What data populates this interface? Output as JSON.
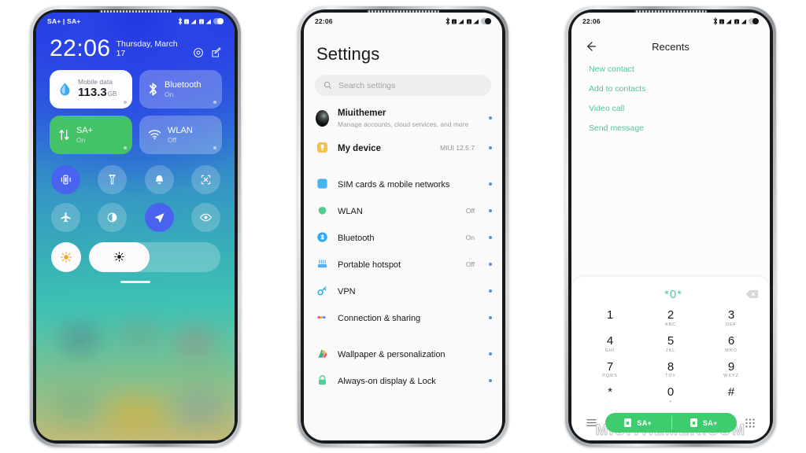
{
  "page": {
    "background": "#ffffff",
    "watermark": "MIUITHEMER.COM"
  },
  "control_center": {
    "status_bar": {
      "carrier": "SA+ | SA+",
      "icons": [
        "bluetooth-icon",
        "sim1-signal-icon",
        "sim2-signal-icon",
        "battery-icon"
      ]
    },
    "clock": {
      "time": "22:06",
      "date": "Thursday, March 17"
    },
    "header_icons": [
      "settings-gear-icon",
      "edit-icon"
    ],
    "big_tiles": [
      {
        "name": "mobile-data",
        "label": "Mobile data",
        "value": "113.3",
        "unit": "GB",
        "style": "white",
        "icon": "water-drop-icon"
      },
      {
        "name": "bluetooth",
        "label": "Bluetooth",
        "value": "On",
        "style": "blue",
        "icon": "bluetooth-icon"
      },
      {
        "name": "sa-plus",
        "label": "SA+",
        "value": "On",
        "style": "green",
        "icon": "data-transfer-icon"
      },
      {
        "name": "wlan",
        "label": "WLAN",
        "value": "Off",
        "style": "blue",
        "icon": "wifi-icon"
      }
    ],
    "toggles": [
      {
        "name": "vibrate",
        "icon": "vibrate-icon",
        "active": true
      },
      {
        "name": "flashlight",
        "icon": "flashlight-icon",
        "active": false
      },
      {
        "name": "silent",
        "icon": "bell-icon",
        "active": false
      },
      {
        "name": "screenshot",
        "icon": "screenshot-icon",
        "active": false
      },
      {
        "name": "airplane-mode",
        "icon": "airplane-icon",
        "active": false
      },
      {
        "name": "dark-mode",
        "icon": "contrast-icon",
        "active": false
      },
      {
        "name": "location",
        "icon": "location-arrow-icon",
        "active": true
      },
      {
        "name": "reading-mode",
        "icon": "eye-icon",
        "active": false
      }
    ],
    "brightness": {
      "auto_icon": "sun-auto-icon",
      "slider_icon": "brightness-icon",
      "level_percent": 46
    }
  },
  "settings": {
    "status_bar": {
      "time": "22:06",
      "icons": [
        "bluetooth-icon",
        "sim1-signal-icon",
        "sim2-signal-icon",
        "battery-icon"
      ]
    },
    "title": "Settings",
    "search_placeholder": "Search settings",
    "account": {
      "name": "Miuithemer",
      "subtitle": "Manage accounts, cloud services, and more",
      "icon": "avatar"
    },
    "items": [
      {
        "label": "My device",
        "value": "MIUI 12.5.7",
        "icon": "device-icon",
        "bold": true
      },
      {
        "label": "SIM cards & mobile networks",
        "value": "",
        "icon": "sim-card-icon",
        "group_start": true
      },
      {
        "label": "WLAN",
        "value": "Off",
        "icon": "wifi-icon"
      },
      {
        "label": "Bluetooth",
        "value": "On",
        "icon": "bluetooth-icon"
      },
      {
        "label": "Portable hotspot",
        "value": "Off",
        "icon": "hotspot-icon"
      },
      {
        "label": "VPN",
        "value": "",
        "icon": "vpn-key-icon"
      },
      {
        "label": "Connection & sharing",
        "value": "",
        "icon": "connection-sharing-icon"
      },
      {
        "label": "Wallpaper & personalization",
        "value": "",
        "icon": "wallpaper-icon",
        "group_start": true
      },
      {
        "label": "Always-on display & Lock",
        "value": "",
        "icon": "lock-screen-icon"
      }
    ]
  },
  "dialer": {
    "status_bar": {
      "time": "22:06",
      "icons": [
        "bluetooth-icon",
        "sim1-signal-icon",
        "sim2-signal-icon",
        "battery-icon"
      ]
    },
    "back_icon": "back-arrow-icon",
    "title": "Recents",
    "actions": [
      "New contact",
      "Add to contacts",
      "Video call",
      "Send message"
    ],
    "accent_color": "#4fc5a5",
    "input": {
      "number": "*0*",
      "backspace_icon": "backspace-icon"
    },
    "keys": [
      {
        "digit": "1",
        "letters": ""
      },
      {
        "digit": "2",
        "letters": "ABC"
      },
      {
        "digit": "3",
        "letters": "DEF"
      },
      {
        "digit": "4",
        "letters": "GHI"
      },
      {
        "digit": "5",
        "letters": "JKL"
      },
      {
        "digit": "6",
        "letters": "MNO"
      },
      {
        "digit": "7",
        "letters": "PQRS"
      },
      {
        "digit": "8",
        "letters": "TUV"
      },
      {
        "digit": "9",
        "letters": "WXYZ"
      },
      {
        "digit": "*",
        "letters": ","
      },
      {
        "digit": "0",
        "letters": "+"
      },
      {
        "digit": "#",
        "letters": ""
      }
    ],
    "bottom": {
      "menu_icon": "menu-icon",
      "keypad_icon": "keypad-icon",
      "call_buttons": [
        {
          "label": "SA+",
          "sim": "sim1"
        },
        {
          "label": "SA+",
          "sim": "sim2"
        }
      ],
      "call_color": "#3fcc6f"
    }
  }
}
